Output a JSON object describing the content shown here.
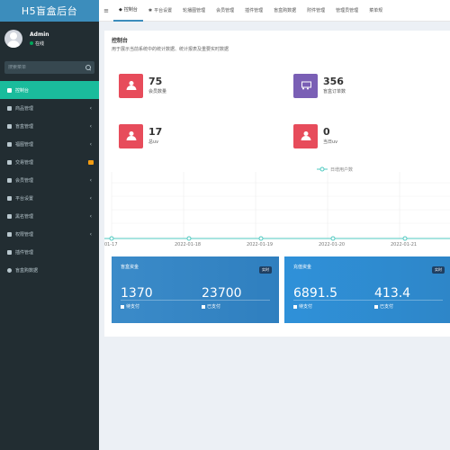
{
  "app": {
    "title": "H5盲盒后台"
  },
  "user": {
    "name": "Admin",
    "status": "在线"
  },
  "search": {
    "placeholder": "搜索菜单"
  },
  "sidebar": {
    "items": [
      {
        "label": "控制台",
        "active": true
      },
      {
        "label": "商品管理"
      },
      {
        "label": "盲盒管理"
      },
      {
        "label": "福图管理"
      },
      {
        "label": "交易管理"
      },
      {
        "label": "会员管理"
      },
      {
        "label": "平台设置"
      },
      {
        "label": "黑名管理"
      },
      {
        "label": "权限管理"
      },
      {
        "label": "插件管理"
      },
      {
        "label": "盲盒购数据"
      }
    ]
  },
  "tabs": [
    {
      "label": "≡",
      "name": "menu-toggle"
    },
    {
      "label": "控制台",
      "active": true
    },
    {
      "label": "平台设置"
    },
    {
      "label": "轮播图管理"
    },
    {
      "label": "会员管理"
    },
    {
      "label": "插件管理"
    },
    {
      "label": "盲盒购数据"
    },
    {
      "label": "附件管理"
    },
    {
      "label": "管理员管理"
    },
    {
      "label": "菜单规"
    }
  ],
  "content": {
    "title": "控制台",
    "subtitle": "用于展示当前系统中的统计数据、统计报表及重要实时数据"
  },
  "stats": [
    {
      "value": "75",
      "label": "会员数量",
      "color": "#e74c5b",
      "icon": "users-icon"
    },
    {
      "value": "356",
      "label": "盲盒订单数",
      "color": "#7a5fb5",
      "icon": "cart-icon"
    },
    {
      "value": "17",
      "label": "总uv",
      "color": "#e74c5b",
      "icon": "users-icon"
    },
    {
      "value": "0",
      "label": "当日uv",
      "color": "#e74c5b",
      "icon": "users-icon"
    }
  ],
  "chart_data": {
    "type": "line",
    "legend": "日增用户数",
    "x": [
      "01-17",
      "2022-01-18",
      "2022-01-19",
      "2022-01-20",
      "2022-01-21"
    ],
    "values": [
      0,
      0,
      0,
      0,
      0
    ],
    "color": "#4fc9c0"
  },
  "panels": [
    {
      "title": "盲盒资金",
      "badge": "实时",
      "v1": "1370",
      "l1": "待支付",
      "v2": "23700",
      "l2": "已支付"
    },
    {
      "title": "充值资金",
      "badge": "实时",
      "v1": "6891.5",
      "l1": "待支付",
      "v2": "413.4",
      "l2": "已支付"
    }
  ]
}
